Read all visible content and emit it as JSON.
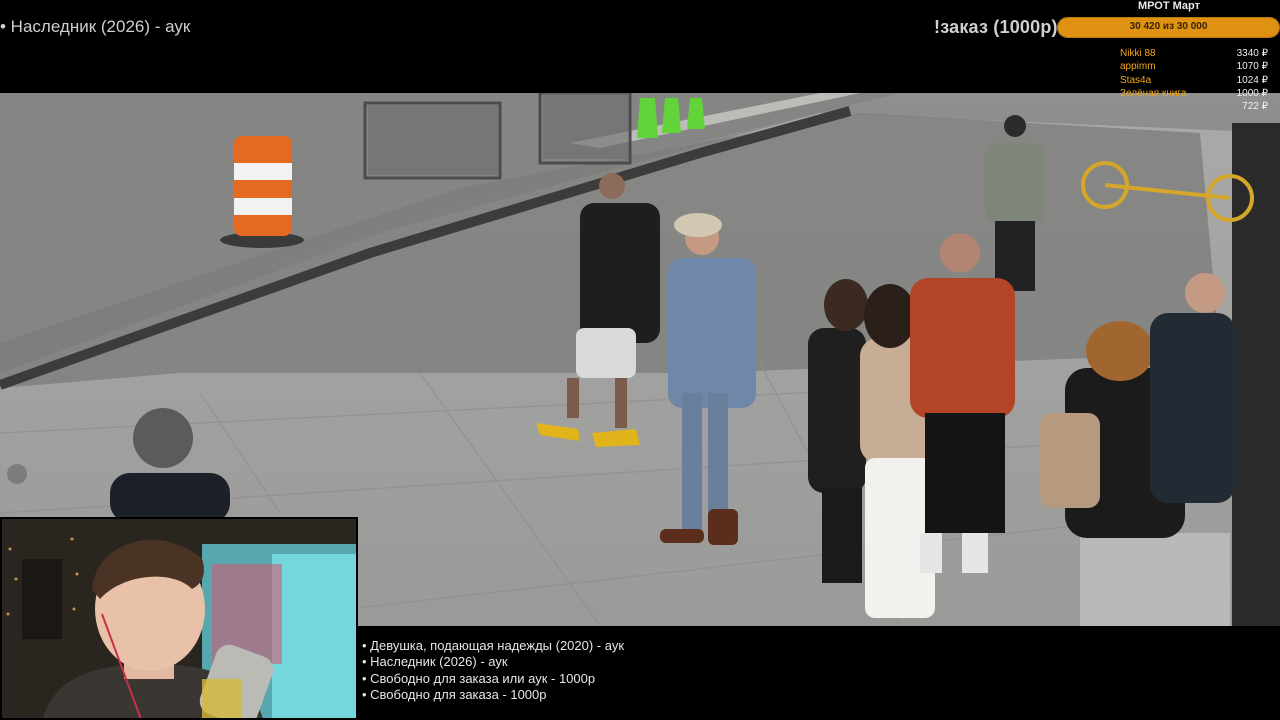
{
  "stream": {
    "now_playing": "• Наследник (2026) - аук",
    "order_label": "!заказ (1000р)"
  },
  "goal": {
    "title": "МРОТ Март",
    "progress_text": "30 420  из 30 000",
    "progress_fraction": 1.0,
    "accent_color": "#df9212"
  },
  "donors": [
    {
      "name": "Nikki 88",
      "amount": "3340 ₽"
    },
    {
      "name": "appimm",
      "amount": "1070 ₽"
    },
    {
      "name": "Stas4a",
      "amount": "1024 ₽"
    },
    {
      "name": "Зелёная книга",
      "amount": "1000 ₽"
    },
    {
      "name": "",
      "amount": "722 ₽"
    }
  ],
  "queue": [
    "• Девушка, подающая надежды (2020) - аук",
    "• Наследник (2026) - аук",
    "• Свободно для заказа или аук - 1000р",
    "• Свободно для заказа - 1000р"
  ]
}
